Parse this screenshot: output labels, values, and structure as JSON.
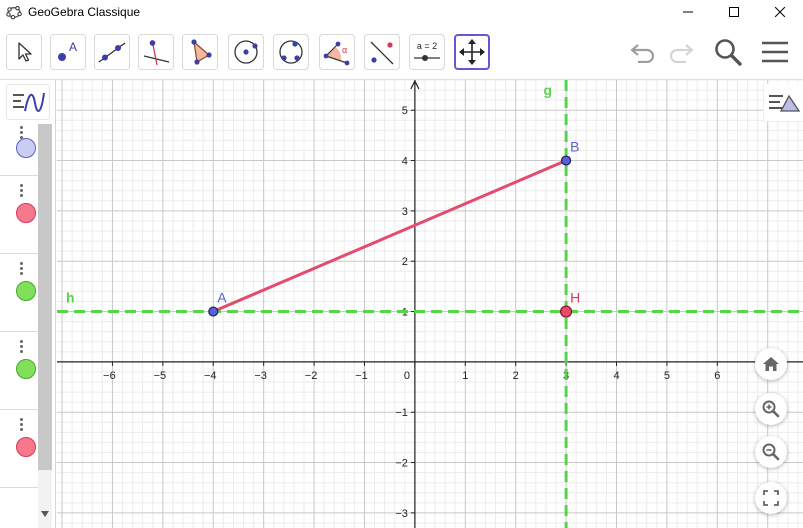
{
  "window": {
    "title": "GeoGebra Classique"
  },
  "toolbar": {
    "tools": [
      {
        "name": "move-tool",
        "icon": "arrow-cursor-icon"
      },
      {
        "name": "point-tool",
        "icon": "point-icon",
        "label": "A"
      },
      {
        "name": "line-tool",
        "icon": "line-icon"
      },
      {
        "name": "perpendicular-line-tool",
        "icon": "perpendicular-line-icon"
      },
      {
        "name": "polygon-tool",
        "icon": "polygon-icon"
      },
      {
        "name": "circle-center-point-tool",
        "icon": "circle-icon"
      },
      {
        "name": "circle-three-points-tool",
        "icon": "circle-three-points-icon"
      },
      {
        "name": "angle-tool",
        "icon": "angle-icon",
        "label": "α"
      },
      {
        "name": "reflect-tool",
        "icon": "reflect-icon"
      },
      {
        "name": "slider-tool",
        "icon": "slider-icon",
        "label": "a = 2"
      },
      {
        "name": "move-graphics-view-tool",
        "icon": "move-graphics-icon",
        "selected": true
      }
    ],
    "undo_icon": "undo-icon",
    "redo_icon": "redo-icon",
    "search_icon": "search-icon",
    "menu_icon": "menu-icon"
  },
  "algebra": {
    "header_icon": "algebra-view-icon",
    "items": [
      {
        "color": "#c9cdf2",
        "border": "#5b5fc7"
      },
      {
        "color": "#f5788c",
        "border": "#d6385a"
      },
      {
        "color": "#80e05a",
        "border": "#44a82e"
      },
      {
        "color": "#80e05a",
        "border": "#44a82e"
      },
      {
        "color": "#f5788c",
        "border": "#d6385a"
      }
    ]
  },
  "graphics": {
    "style_bar_icon": "graphics-style-bar-icon",
    "x_ticks": [
      "−6",
      "−5",
      "−4",
      "−3",
      "−2",
      "−1",
      "0",
      "1",
      "2",
      "3",
      "4",
      "5",
      "6"
    ],
    "y_ticks": [
      "5",
      "4",
      "3",
      "2",
      "1",
      "−1",
      "−2",
      "−3"
    ],
    "xlim": [
      -7.1,
      7.7
    ],
    "ylim": [
      -3.3,
      5.6
    ],
    "points": [
      {
        "label": "A",
        "x": -4,
        "y": 1,
        "color": "#5b5fc7"
      },
      {
        "label": "B",
        "x": 3,
        "y": 4,
        "color": "#5b5fc7"
      },
      {
        "label": "H",
        "x": 3,
        "y": 1,
        "color": "#d6385a"
      }
    ],
    "segment": {
      "from": "A",
      "to": "B",
      "color": "#e44b6d"
    },
    "lines": [
      {
        "label": "g",
        "type": "vertical",
        "value": 3,
        "color": "#55d64a"
      },
      {
        "label": "h",
        "type": "horizontal",
        "value": 1,
        "color": "#55d64a"
      }
    ],
    "buttons": {
      "home": "home-icon",
      "zoom_in": "zoom-in-icon",
      "zoom_out": "zoom-out-icon",
      "fullscreen": "fullscreen-icon"
    }
  }
}
